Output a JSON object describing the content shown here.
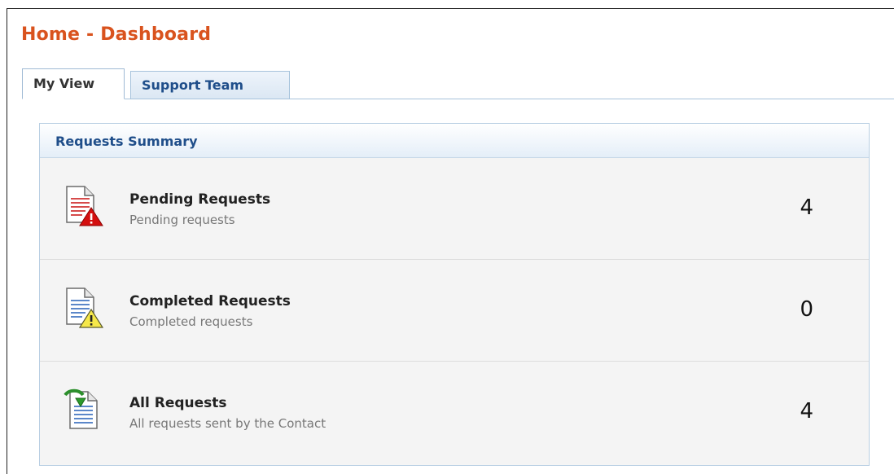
{
  "page": {
    "title": "Home - Dashboard"
  },
  "tabs": [
    {
      "label": "My View",
      "active": true
    },
    {
      "label": "Support Team",
      "active": false
    }
  ],
  "summary": {
    "title": "Requests Summary",
    "rows": [
      {
        "title": "Pending Requests",
        "subtitle": "Pending requests",
        "count": "4",
        "icon": "document-error-icon"
      },
      {
        "title": "Completed Requests",
        "subtitle": "Completed requests",
        "count": "0",
        "icon": "document-warning-icon"
      },
      {
        "title": "All Requests",
        "subtitle": "All requests sent by the Contact",
        "count": "4",
        "icon": "document-arrow-icon"
      }
    ]
  },
  "colors": {
    "title": "#d9531e",
    "tab_text": "#1f4e8a",
    "panel_border": "#b9cfe3"
  }
}
